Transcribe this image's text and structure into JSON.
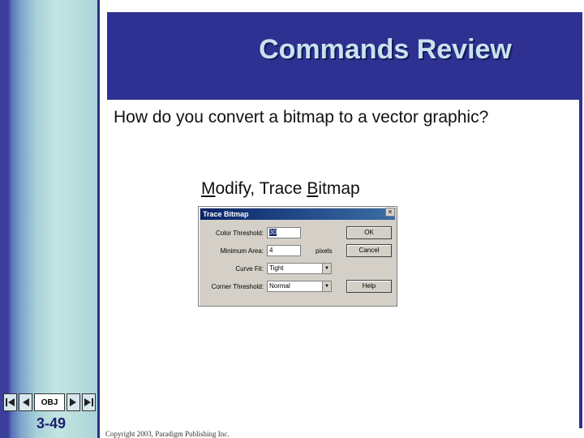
{
  "slide": {
    "title": "Commands Review",
    "question": "How do you convert a bitmap to a vector graphic?",
    "answer_parts": {
      "m": "M",
      "odify": "odify, Trace ",
      "b": "B",
      "itmap": "itmap"
    },
    "number": "3-49",
    "copyright": "Copyright 2003, Paradigm Publishing Inc."
  },
  "nav": {
    "obj_label": "OBJ"
  },
  "dialog": {
    "title": "Trace Bitmap",
    "close_glyph": "×",
    "color_threshold_label": "Color Threshold:",
    "color_threshold_value": "30",
    "minimum_area_label": "Minimum Area:",
    "minimum_area_value": "4",
    "minimum_area_unit": "pixels",
    "curve_fit_label": "Curve Fit:",
    "curve_fit_value": "Tight",
    "corner_threshold_label": "Corner Threshold:",
    "corner_threshold_value": "Normal",
    "ok_label": "OK",
    "cancel_label": "Cancel",
    "help_label": "Help"
  },
  "colors": {
    "title_bar": "#2e3192",
    "title_text": "#c9e2f0",
    "accent_dark": "#1a1f6e"
  }
}
